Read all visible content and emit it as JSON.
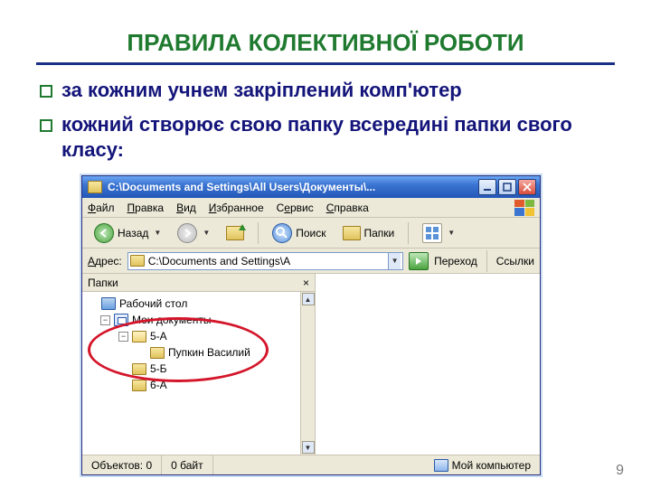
{
  "slide": {
    "title": "ПРАВИЛА КОЛЕКТИВНОЇ РОБОТИ",
    "bullets": [
      "за кожним учнем закріплений комп'ютер",
      "кожний створює свою папку всередині папки свого класу:"
    ],
    "page_number": "9"
  },
  "explorer": {
    "title": "C:\\Documents and Settings\\All Users\\Документы\\...",
    "menus": [
      "Файл",
      "Правка",
      "Вид",
      "Избранное",
      "Сервис",
      "Справка"
    ],
    "toolbar": {
      "back": "Назад",
      "search": "Поиск",
      "folders": "Папки"
    },
    "address": {
      "label": "Адрес:",
      "value": "C:\\Documents and Settings\\A",
      "go": "Переход",
      "links": "Ссылки"
    },
    "folders_pane": {
      "header": "Папки"
    },
    "tree": {
      "desktop": "Рабочий стол",
      "mydocs": "Мои документы",
      "n5a": "5-А",
      "pupkin": "Пупкин Василий",
      "n5b": "5-Б",
      "n6a": "6-А"
    },
    "status": {
      "objects": "Объектов: 0",
      "size": "0 байт",
      "location": "Мой компьютер"
    }
  }
}
